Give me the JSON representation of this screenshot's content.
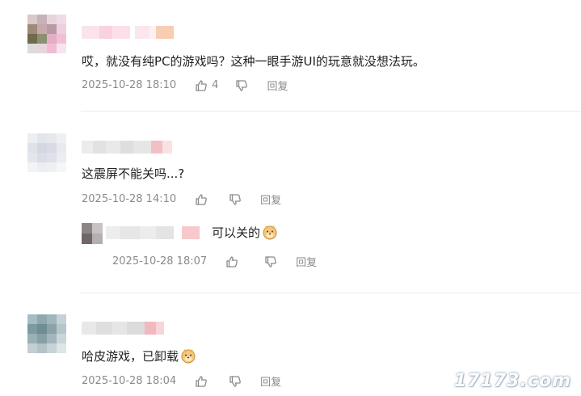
{
  "comments": [
    {
      "text": "哎，就没有纯PC的游戏吗？这种一眼手游UI的玩意就没想法玩。",
      "time": "2025-10-28 18:10",
      "likes": "4",
      "reply_label": "回复"
    },
    {
      "text": "这震屏不能关吗...?",
      "time": "2025-10-28 14:10",
      "likes": "",
      "reply_label": "回复",
      "replies": [
        {
          "text": "可以关的",
          "emoji": "doge-emoji",
          "time": "2025-10-28 18:07",
          "reply_label": "回复"
        }
      ]
    },
    {
      "text": "哈皮游戏，已卸载",
      "emoji": "doge-emoji",
      "time": "2025-10-28 18:04",
      "likes": "",
      "reply_label": "回复"
    }
  ],
  "icons": {
    "like": "thumbs-up-icon",
    "dislike": "thumbs-down-icon"
  },
  "watermark": "17173.com"
}
